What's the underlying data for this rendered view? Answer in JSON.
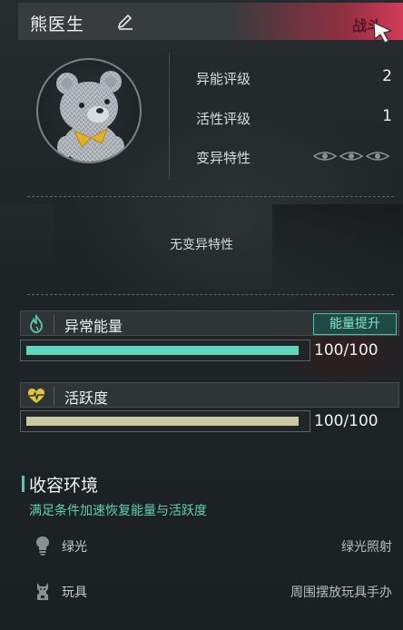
{
  "character": {
    "name": "熊医生",
    "fight_label": "战斗"
  },
  "stats": [
    {
      "label": "异能评级",
      "value": "2"
    },
    {
      "label": "活性评级",
      "value": "1"
    },
    {
      "label": "变异特性",
      "value": ""
    }
  ],
  "mutation": {
    "empty_text": "无变异特性"
  },
  "energy": {
    "title": "异常能量",
    "boost_label": "能量提升",
    "value_text": "100/100",
    "fill_fraction": 1.0,
    "bar_color": "#5fd6bd"
  },
  "activity": {
    "title": "活跃度",
    "value_text": "100/100",
    "fill_fraction": 1.0,
    "bar_color": "#c9c8a2"
  },
  "environment": {
    "title": "收容环境",
    "subtitle": "满足条件加速恢复能量与活跃度",
    "rows": [
      {
        "icon": "lightbulb-icon",
        "label": "绿光",
        "value": "绿光照射"
      },
      {
        "icon": "toy-icon",
        "label": "玩具",
        "value": "周围摆放玩具手办"
      }
    ]
  },
  "colors": {
    "accent": "#57c9b0",
    "header_right": "#dc3c5a"
  }
}
